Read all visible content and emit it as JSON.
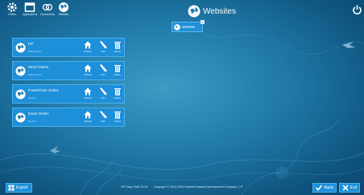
{
  "top_tabs": [
    {
      "label": "Online",
      "icon": "gear-icon"
    },
    {
      "label": "Applications",
      "icon": "window-icon"
    },
    {
      "label": "Documents",
      "icon": "link-icon"
    },
    {
      "label": "Website",
      "icon": "globe-icon"
    }
  ],
  "header": {
    "title": "Websites",
    "icon": "globe-icon"
  },
  "power": {
    "icon": "power-icon"
  },
  "filter_chip": {
    "label": "Website",
    "icon": "globe-icon",
    "close_icon": "close-icon"
  },
  "actions": {
    "default_label": "Default",
    "edit_label": "Edit",
    "delete_label": "Delete"
  },
  "websites": [
    {
      "name": "HP",
      "url": "www.hp.com"
    },
    {
      "name": "Word Online",
      "url": "www.hp.com"
    },
    {
      "name": "PowerPoint Online",
      "url": "hp.com"
    },
    {
      "name": "Excel Online",
      "url": "hp.com"
    }
  ],
  "footer": {
    "export_label": "Export",
    "version": "HP Easy Shell 10.3X",
    "copyright": "Copyright © 2012-2015 Hewlett-Packard Development Company, L.P.",
    "apply_label": "Apply",
    "exit_label": "Exit"
  },
  "colors": {
    "accent": "#1e8fd9",
    "card_border": "#4bb0ec",
    "bg_dark": "#0a4670",
    "bg_light": "#3d9bc4"
  }
}
